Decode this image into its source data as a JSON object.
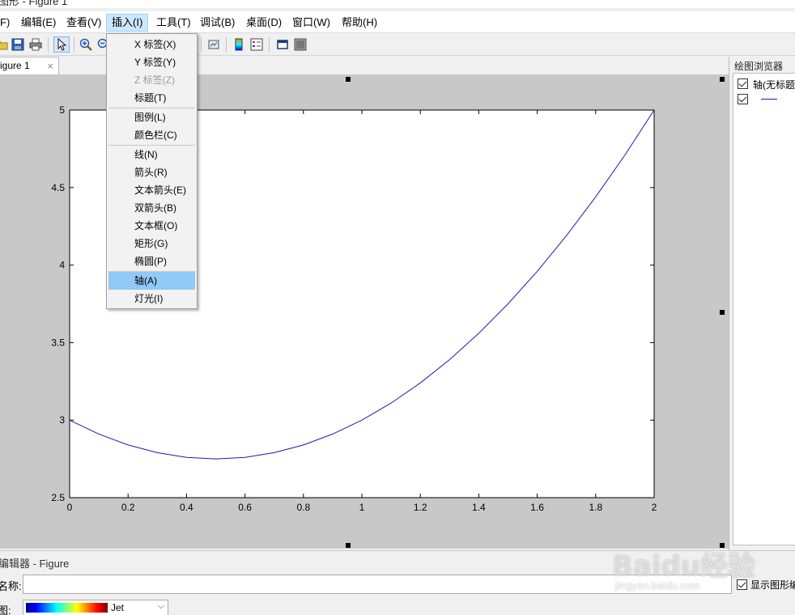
{
  "window": {
    "title": "图形 - Figure 1"
  },
  "menubar": {
    "items": [
      {
        "label": "F)"
      },
      {
        "label": "编辑(E)"
      },
      {
        "label": "查看(V)"
      },
      {
        "label": "插入(I)"
      },
      {
        "label": "工具(T)"
      },
      {
        "label": "调试(B)"
      },
      {
        "label": "桌面(D)"
      },
      {
        "label": "窗口(W)"
      },
      {
        "label": "帮助(H)"
      }
    ]
  },
  "insert_menu": {
    "items": [
      {
        "label": "X 标签(X)",
        "enabled": true
      },
      {
        "label": "Y 标签(Y)",
        "enabled": true
      },
      {
        "label": "Z 标签(Z)",
        "enabled": false
      },
      {
        "label": "标题(T)",
        "enabled": true
      },
      {
        "label": "图例(L)",
        "enabled": true
      },
      {
        "label": "颜色栏(C)",
        "enabled": true
      },
      {
        "label": "线(N)",
        "enabled": true
      },
      {
        "label": "箭头(R)",
        "enabled": true
      },
      {
        "label": "文本箭头(E)",
        "enabled": true
      },
      {
        "label": "双箭头(B)",
        "enabled": true
      },
      {
        "label": "文本框(O)",
        "enabled": true
      },
      {
        "label": "矩形(G)",
        "enabled": true
      },
      {
        "label": "椭圆(P)",
        "enabled": true
      },
      {
        "label": "轴(A)",
        "enabled": true,
        "highlighted": true
      },
      {
        "label": "灯光(I)",
        "enabled": true
      }
    ]
  },
  "tab": {
    "label": "igure 1",
    "close": "×"
  },
  "plot_browser": {
    "title": "绘图浏览器",
    "axes_label": "轴(无标题)"
  },
  "property_editor": {
    "title": "编辑器 - Figure",
    "name_label": "名称:",
    "name_value": "",
    "colormap_label": "图:",
    "colormap_value": "Jet",
    "show_label": "显示图形编"
  },
  "chart_data": {
    "type": "line",
    "series": [
      {
        "x": [
          0,
          0.1,
          0.2,
          0.3,
          0.4,
          0.5,
          0.6,
          0.7,
          0.8,
          0.9,
          1.0,
          1.1,
          1.2,
          1.3,
          1.4,
          1.5,
          1.6,
          1.7,
          1.8,
          1.9,
          2.0
        ],
        "y": [
          3.0,
          2.91,
          2.84,
          2.79,
          2.76,
          2.75,
          2.76,
          2.79,
          2.84,
          2.91,
          3.0,
          3.11,
          3.24,
          3.39,
          3.56,
          3.75,
          3.96,
          4.19,
          4.44,
          4.71,
          5.0
        ],
        "color": "#1a1ab0"
      }
    ],
    "xlim": [
      0,
      2
    ],
    "ylim": [
      2.5,
      5
    ],
    "xticks": [
      "0",
      "0.2",
      "0.4",
      "0.6",
      "0.8",
      "1",
      "1.2",
      "1.4",
      "1.6",
      "1.8",
      "2"
    ],
    "yticks": [
      "2.5",
      "3",
      "3.5",
      "4",
      "4.5",
      "5"
    ],
    "grid": false,
    "title": "",
    "xlabel": "",
    "ylabel": ""
  },
  "watermark": {
    "text": "Baidu经验",
    "sub": "jingyan.baidu.com"
  }
}
